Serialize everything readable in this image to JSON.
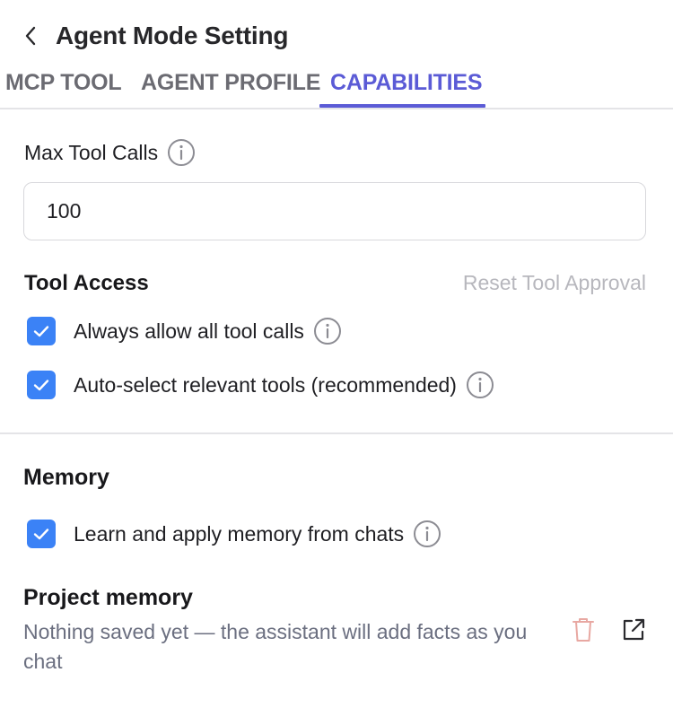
{
  "header": {
    "title": "Agent Mode Setting",
    "back_icon": "chevron-left-icon"
  },
  "tabs": [
    {
      "label": "MCP TOOL",
      "active": false
    },
    {
      "label": "AGENT PROFILE",
      "active": false
    },
    {
      "label": "CAPABILITIES",
      "active": true
    }
  ],
  "capabilities": {
    "max_tool_calls": {
      "label": "Max Tool Calls",
      "value": "100",
      "info_icon": "info-icon"
    },
    "tool_access": {
      "title": "Tool Access",
      "reset_label": "Reset Tool Approval",
      "options": [
        {
          "label": "Always allow all tool calls",
          "checked": true
        },
        {
          "label": "Auto-select relevant tools (recommended)",
          "checked": true
        }
      ]
    },
    "memory": {
      "title": "Memory",
      "options": [
        {
          "label": "Learn and apply memory from chats",
          "checked": true
        }
      ]
    },
    "project_memory": {
      "title": "Project memory",
      "description": "Nothing saved yet — the assistant will add facts as you chat",
      "delete_icon": "trash-icon",
      "open_icon": "external-link-icon"
    }
  },
  "colors": {
    "accent": "#5b5bd6",
    "checkbox": "#3b82f6",
    "trash": "#e8a8a2",
    "muted": "#b7b7bd"
  }
}
